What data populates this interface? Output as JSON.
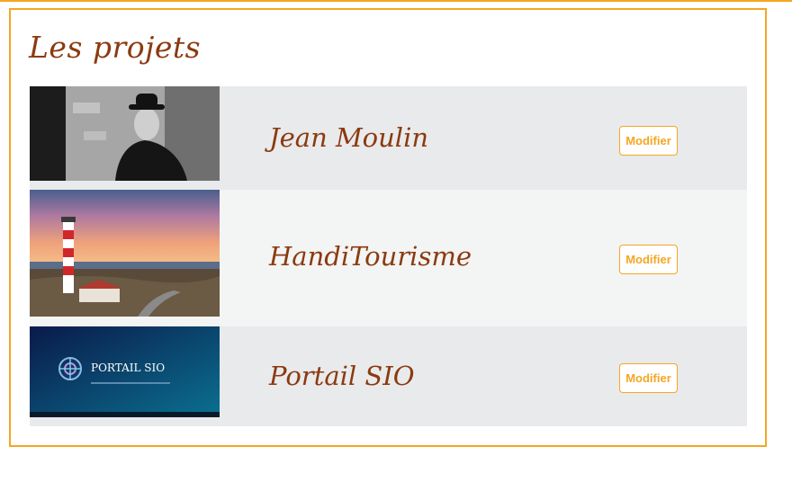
{
  "page": {
    "title": "Les projets"
  },
  "projects": [
    {
      "name": "Jean Moulin",
      "button_label": "Modifier",
      "image": "portrait-photo"
    },
    {
      "name": "HandiTourisme",
      "button_label": "Modifier",
      "image": "lighthouse-photo"
    },
    {
      "name": "Portail SIO",
      "button_label": "Modifier",
      "image": "portail-sio-banner",
      "image_text": "PORTAIL SIO"
    }
  ],
  "colors": {
    "accent": "#f5a623",
    "title": "#8b3a10",
    "row_dark": "#e9eaec",
    "row_light": "#f3f4f4"
  }
}
